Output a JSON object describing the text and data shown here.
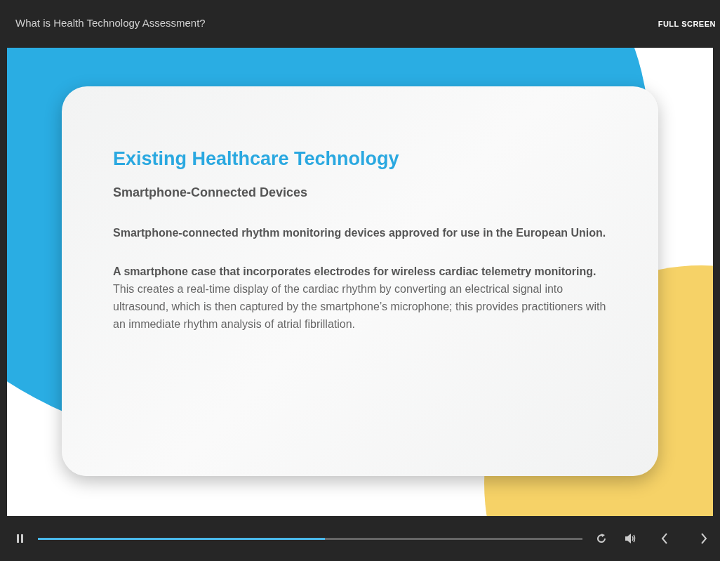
{
  "window": {
    "title": "What is Health Technology Assessment?",
    "full_screen_label": "FULL SCREEN"
  },
  "slide": {
    "title": "Existing Healthcare Technology",
    "subtitle": "Smartphone-Connected Devices",
    "paragraphs": [
      "**Smartphone-connected rhythm monitoring devices approved for use in the European Union.**",
      "**A smartphone case that incorporates electrodes for wireless cardiac telemetry monitoring.** This creates a real-time display of the cardiac rhythm by converting an electrical signal into ultrasound, which is then captured by the smartphone’s microphone; this provides practitioners with an immediate rhythm analysis of atrial fibrillation."
    ]
  },
  "player": {
    "playing": true,
    "progress": {
      "level": 0.527
    }
  }
}
